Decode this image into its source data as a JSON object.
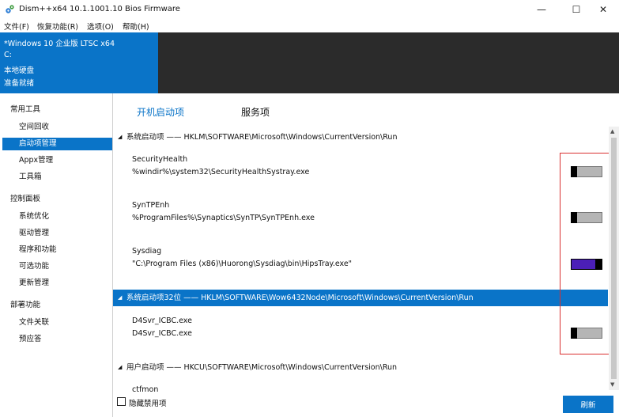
{
  "window": {
    "title": "Dism++x64 10.1.1001.10 Bios Firmware",
    "min_glyph": "—",
    "max_glyph": "☐",
    "close_glyph": "✕",
    "icon": "gears-icon"
  },
  "menu": [
    "文件(F)",
    "恢复功能(R)",
    "选项(O)",
    "帮助(H)"
  ],
  "system_info": {
    "os": "*Windows 10 企业版 LTSC x64",
    "drive": "C:",
    "disk_type": "本地硬盘",
    "status": "准备就绪"
  },
  "sidebar": {
    "groups": [
      {
        "title": "常用工具",
        "items": [
          "空间回收",
          "启动项管理",
          "Appx管理",
          "工具箱"
        ]
      },
      {
        "title": "控制面板",
        "items": [
          "系统优化",
          "驱动管理",
          "程序和功能",
          "可选功能",
          "更新管理"
        ]
      },
      {
        "title": "部署功能",
        "items": [
          "文件关联",
          "预应答"
        ]
      }
    ],
    "selected": "启动项管理"
  },
  "tabs": [
    "开机启动项",
    "服务项"
  ],
  "sections": [
    {
      "label": "系统启动项 —— HKLM\\SOFTWARE\\Microsoft\\Windows\\CurrentVersion\\Run"
    },
    {
      "label": "系统启动项32位 —— HKLM\\SOFTWARE\\Wow6432Node\\Microsoft\\Windows\\CurrentVersion\\Run"
    },
    {
      "label": "用户启动项 —— HKCU\\SOFTWARE\\Microsoft\\Windows\\CurrentVersion\\Run"
    }
  ],
  "entries": [
    {
      "name": "SecurityHealth",
      "path": "%windir%\\system32\\SecurityHealthSystray.exe",
      "enabled": false
    },
    {
      "name": "SynTPEnh",
      "path": "%ProgramFiles%\\Synaptics\\SynTP\\SynTPEnh.exe",
      "enabled": false
    },
    {
      "name": "Sysdiag",
      "path": "\"C:\\Program Files (x86)\\Huorong\\Sysdiag\\bin\\HipsTray.exe\"",
      "enabled": true
    },
    {
      "name": "D4Svr_ICBC.exe",
      "path": "D4Svr_ICBC.exe",
      "enabled": false
    },
    {
      "name": "ctfmon",
      "path": "",
      "enabled": null
    }
  ],
  "footer": {
    "hide_disabled_label": "隐藏禁用项",
    "refresh_label": "刷新"
  },
  "colors": {
    "accent": "#0a74c8",
    "toggle_on": "#4b1fb8",
    "highlight_box": "#d93030"
  }
}
